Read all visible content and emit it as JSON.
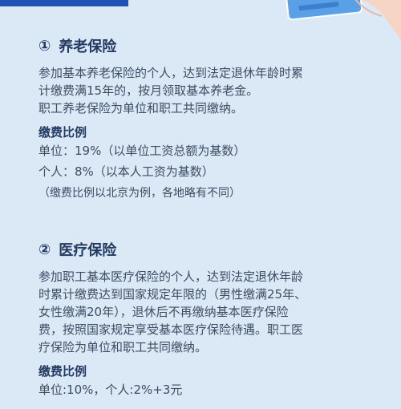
{
  "section1": {
    "number": "①",
    "title": "养老保险",
    "paragraph_lines": [
      "参加基本养老保险的个人，达到法定退休年龄时累",
      "计缴费满15年的，按月领取基本养老金。",
      "职工养老保险为单位和职工共同缴纳。"
    ],
    "rate_heading": "缴费比例",
    "rate_lines": [
      "单位：19%（以单位工资总额为基数）",
      "个人：8%（以本人工资为基数）"
    ],
    "note": "（缴费比例以北京为例，各地略有不同）"
  },
  "section2": {
    "number": "②",
    "title": "医疗保险",
    "paragraph_lines": [
      "参加职工基本医疗保险的个人，达到法定退休年龄",
      "时累计缴费达到国家规定年限的（男性缴满25年、",
      "女性缴满20年），退休后不再缴纳基本医疗保险",
      "费，按照国家规定享受基本医疗保险待遇。职工医",
      "疗保险为单位和职工共同缴纳。"
    ],
    "rate_heading": "缴费比例",
    "rate_line": "单位:10%，个人:2%+3元"
  },
  "colors": {
    "background": "#dbe8f6",
    "heading": "#233a63",
    "text": "#3d4d63",
    "accent": "#1c55b5"
  }
}
